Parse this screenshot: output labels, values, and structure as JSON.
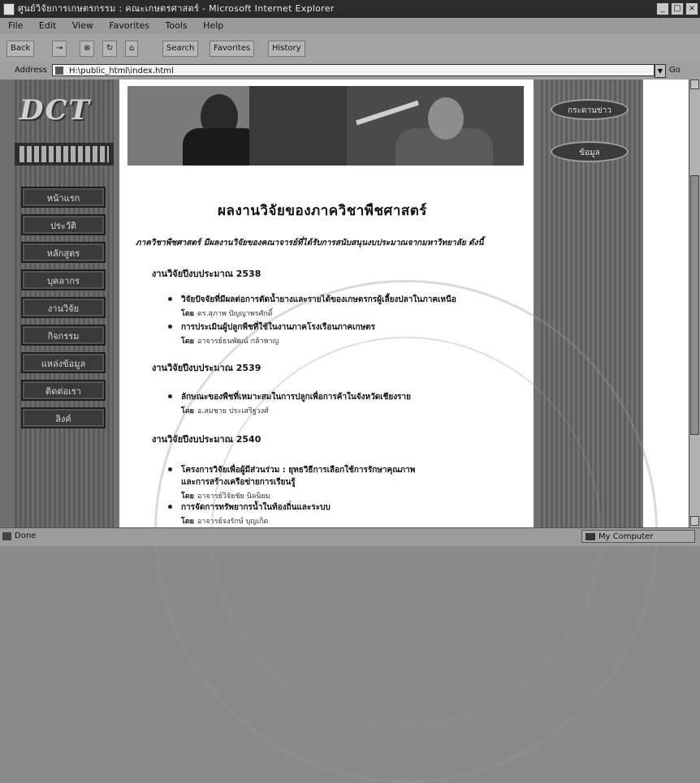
{
  "window": {
    "title": "ศูนย์วิจัยการเกษตรกรรม : คณะเกษตรศาสตร์ - Microsoft Internet Explorer",
    "controls": [
      "_",
      "□",
      "×"
    ]
  },
  "menubar": {
    "items": [
      "File",
      "Edit",
      "View",
      "Favorites",
      "Tools",
      "Help"
    ]
  },
  "toolbar": {
    "back": "Back",
    "forward": "→",
    "stop": "⊗",
    "refresh": "↻",
    "home": "⌂",
    "search": "Search",
    "favorites": "Favorites",
    "history": "History"
  },
  "address": {
    "label": "Address",
    "value": "H:\\public_html\\index.html",
    "go": "Go"
  },
  "left_nav": {
    "logo_text": "DCT",
    "items": [
      "หน้าแรก",
      "ประวัติ",
      "หลักสูตร",
      "บุคลากร",
      "งานวิจัย",
      "กิจกรรม",
      "แหล่งข้อมูล",
      "ติดต่อเรา",
      "ลิงค์"
    ]
  },
  "right_nav": {
    "items": [
      "กระดานข่าว",
      "ข้อมูล"
    ]
  },
  "content": {
    "heading": "ผลงานวิจัยของภาควิชาพืชศาสตร์",
    "intro": "ภาควิชาพืชศาสตร์ มีผลงานวิจัยของคณาจารย์ที่ได้รับการสนับสนุนงบประมาณจากมหาวิทยาลัย ดังนี้",
    "sections": [
      {
        "title": "งานวิจัยปีงบประมาณ 2538",
        "items": [
          {
            "title": "วิจัยปัจจัยที่มีผลต่อการตัดน้ำยางและรายได้ของเกษตรกรผู้เลี้ยงปลาในภาคเหนือ",
            "by_label": "โดย",
            "by": "ดร.สุภาพ ปัญญาพรศักดิ์"
          },
          {
            "title": "การประเมินผู้ปลูกพืชที่ใช้ในงานภาคโรงเรือนภาคเกษตร",
            "by_label": "โดย",
            "by": "อาจารย์ธนพัฒน์ กล้าหาญ"
          }
        ]
      },
      {
        "title": "งานวิจัยปีงบประมาณ 2539",
        "items": [
          {
            "title": "ลักษณะของพืชที่เหมาะสมในการปลูกเพื่อการค้าในจังหวัดเชียงราย",
            "by_label": "โดย",
            "by": "อ.สมชาย ประเสริฐวงศ์"
          }
        ]
      },
      {
        "title": "งานวิจัยปีงบประมาณ 2540",
        "items": [
          {
            "title": "โครงการวิจัยเพื่อผู้มีส่วนร่วม : ยุทธวิธีการเลือกใช้การรักษาคุณภาพ",
            "title2": "และการสร้างเครือข่ายการเรียนรู้",
            "by_label": "โดย",
            "by": "อาจารย์วิจัยชัย นิลนิยม"
          },
          {
            "title": "การจัดการทรัพยากรน้ำในท้องถิ่นและระบบ",
            "by_label": "โดย",
            "by": "อาจารย์จงรักษ์ บุญเกิด"
          }
        ]
      }
    ]
  },
  "status": {
    "text": "Done",
    "zone": "My Computer"
  }
}
